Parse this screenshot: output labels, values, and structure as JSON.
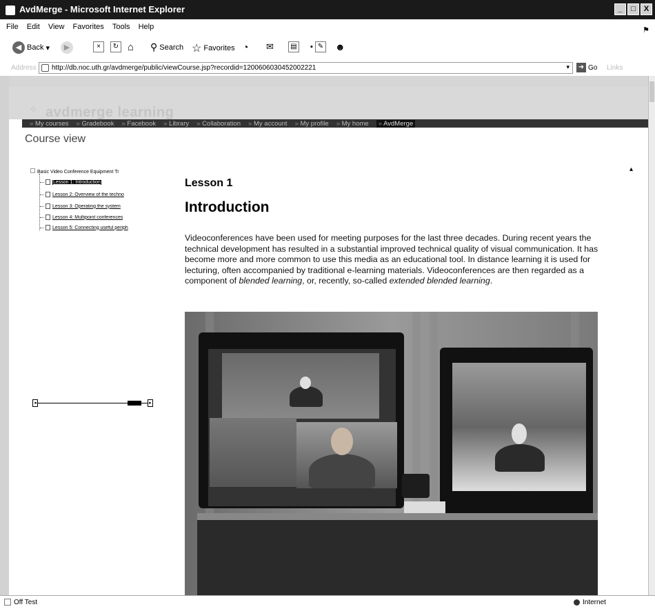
{
  "window": {
    "title": "AvdMerge - Microsoft Internet Explorer",
    "buttons": [
      "_",
      "□",
      "X"
    ]
  },
  "menu": [
    "File",
    "Edit",
    "View",
    "Favorites",
    "Tools",
    "Help"
  ],
  "toolbar": {
    "back_label": "Back",
    "search_label": "Search",
    "favorites_label": "Favorites"
  },
  "address": {
    "label": "Address",
    "url": "http://db.noc.uth.gr/avdmerge/public/viewCourse.jsp?recordid=1200606030452002221",
    "go_label": "Go",
    "links_label": "Links"
  },
  "site": {
    "logo": "avdmerge learning",
    "nav": [
      "My courses",
      "Gradebook",
      "Facebook",
      "Library",
      "Collaboration",
      "My account",
      "My profile",
      "My home",
      "AvdMerge"
    ],
    "page_heading": "Course view"
  },
  "tree": {
    "root": "Basic Video Conference Equipment Tr",
    "items": [
      "Lesson 1: Introduction",
      "Lesson 2: Overview of the techno",
      "Lesson 3: Operating the system",
      "Lesson 4: Multipoint conferences",
      "Lesson 5: Connecting useful periph"
    ],
    "selected_index": 0
  },
  "lesson": {
    "number": "Lesson 1",
    "title": "Introduction",
    "paragraph_part1": "Videoconferences have been used for meeting purposes for the last three decades. During recent years the technical development has resulted in a substantial improved technical quality of visual communication. It has become more and more common to use this media as an educational tool. In distance learning it is used for lecturing, often accompanied by traditional e-learning materials. Videoconferences are then regarded as a component of ",
    "paragraph_em1": "blended learning",
    "paragraph_part2": ", or, recently, so-called ",
    "paragraph_em2": "extended blended learning",
    "paragraph_end": "."
  },
  "status": {
    "text": "Off Test",
    "zone": "Internet"
  }
}
